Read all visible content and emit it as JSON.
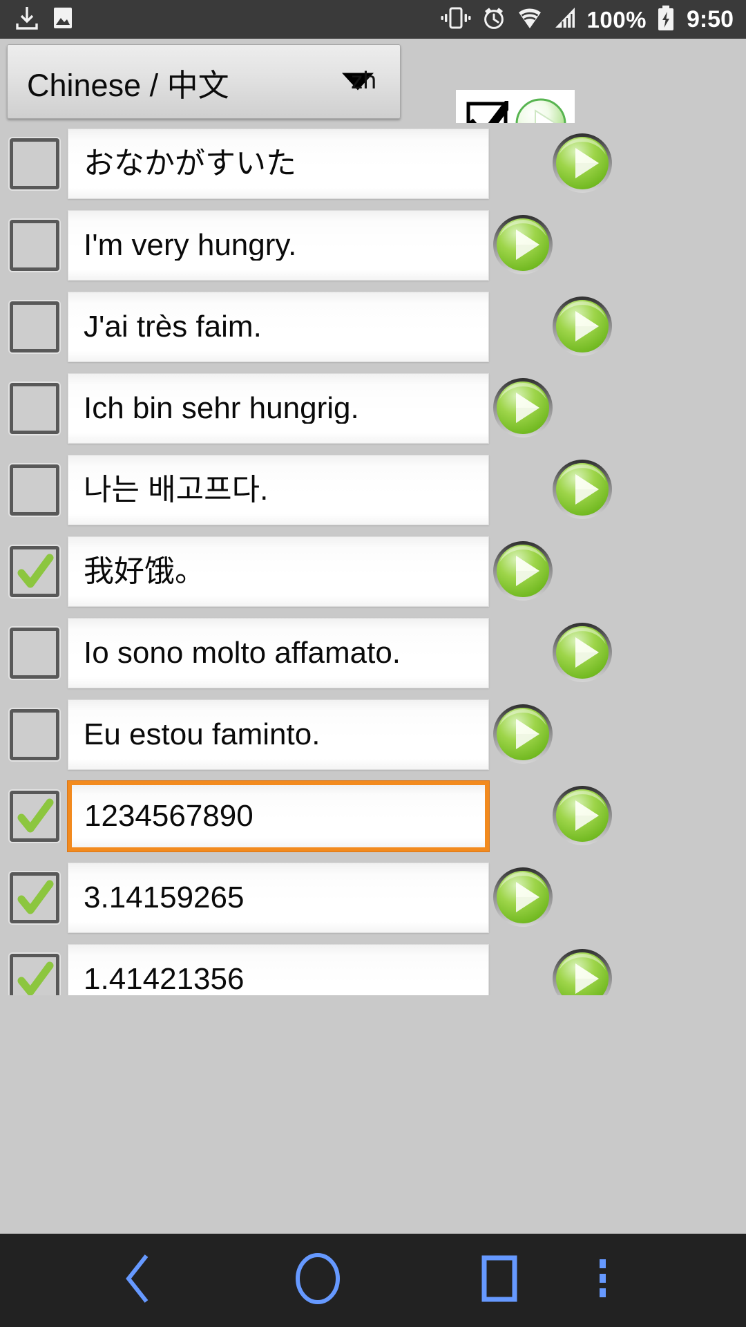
{
  "status_bar": {
    "icons_left": [
      "download-icon",
      "image-icon"
    ],
    "icons_right": [
      "vibrate-icon",
      "alarm-icon",
      "wifi-icon",
      "signal-icon"
    ],
    "battery_percent": "100%",
    "battery_icon": "battery-charging-icon",
    "time": "9:50"
  },
  "toolbar": {
    "language_label": "Chinese / 中文",
    "language_code": "zh",
    "caret_icon": "chevron-down-icon",
    "check_all_icon": "checkbox-checked-icon",
    "play_all_icon": "play-icon"
  },
  "colors": {
    "background": "#c9c9c9",
    "statusbar": "#3a3a3a",
    "navbar": "#222222",
    "focus_orange": "#f28a1e",
    "check_green": "#8cc63f",
    "nav_blue": "#6699ff",
    "field_white": "#ffffff"
  },
  "rows": [
    {
      "checked": false,
      "focused": false,
      "text": "おなかがすいた",
      "play_icon": "play-icon",
      "play_pos": "a"
    },
    {
      "checked": false,
      "focused": false,
      "text": "I'm very hungry.",
      "play_icon": "play-icon",
      "play_pos": "b"
    },
    {
      "checked": false,
      "focused": false,
      "text": "J'ai très faim.",
      "play_icon": "play-icon",
      "play_pos": "a"
    },
    {
      "checked": false,
      "focused": false,
      "text": "Ich bin sehr hungrig.",
      "play_icon": "play-icon",
      "play_pos": "b"
    },
    {
      "checked": false,
      "focused": false,
      "text": "나는 배고프다.",
      "play_icon": "play-icon",
      "play_pos": "a"
    },
    {
      "checked": true,
      "focused": false,
      "text": "我好饿。",
      "play_icon": "play-icon",
      "play_pos": "b"
    },
    {
      "checked": false,
      "focused": false,
      "text": "Io sono molto affamato.",
      "play_icon": "play-icon",
      "play_pos": "a"
    },
    {
      "checked": false,
      "focused": false,
      "text": "Eu estou faminto.",
      "play_icon": "play-icon",
      "play_pos": "b"
    },
    {
      "checked": true,
      "focused": true,
      "text": "1234567890",
      "play_icon": "play-icon",
      "play_pos": "a"
    },
    {
      "checked": true,
      "focused": false,
      "text": "3.14159265",
      "play_icon": "play-icon",
      "play_pos": "b"
    },
    {
      "checked": true,
      "focused": false,
      "text": "1.41421356",
      "play_icon": "play-icon",
      "play_pos": "a"
    }
  ],
  "navbar": {
    "back_icon": "back-chevron-icon",
    "home_icon": "home-circle-icon",
    "recents_icon": "recents-square-icon",
    "menu_icon": "overflow-menu-icon"
  }
}
